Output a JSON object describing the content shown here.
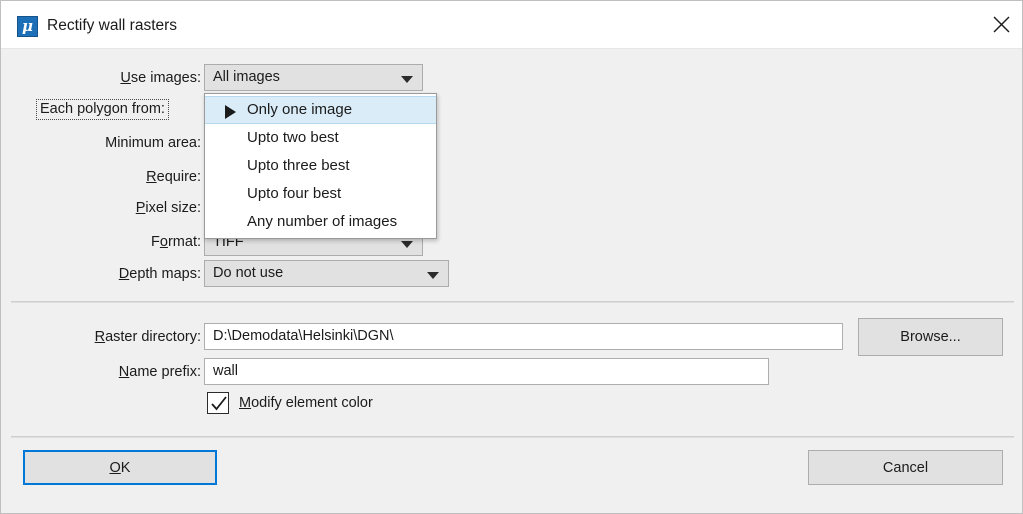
{
  "window": {
    "title": "Rectify wall rasters",
    "app_icon": "mu-icon",
    "close_icon": "close-icon",
    "background_color": "#f0f0f0",
    "accent_color": "#0078d7"
  },
  "form": {
    "rows": [
      {
        "label_prefix": "",
        "label_accel": "U",
        "label_suffix": "se images:",
        "control": "combo",
        "value": "All images"
      },
      {
        "label_prefix": "Each polygon from:",
        "label_accel": "",
        "label_suffix": "",
        "control": "combo-focused",
        "value": ""
      },
      {
        "label_prefix": "Minimum area:",
        "label_accel": "",
        "label_suffix": "",
        "control": "hidden",
        "value": ""
      },
      {
        "label_prefix": "",
        "label_accel": "R",
        "label_suffix": "equire:",
        "control": "hidden",
        "value": ""
      },
      {
        "label_prefix": "",
        "label_accel": "P",
        "label_suffix": "ixel size:",
        "control": "hidden",
        "value": ""
      },
      {
        "label_prefix": "F",
        "label_accel": "o",
        "label_suffix": "rmat:",
        "control": "combo",
        "value": "TIFF"
      },
      {
        "label_prefix": "",
        "label_accel": "D",
        "label_suffix": "epth maps:",
        "control": "combo",
        "value": "Do not use"
      }
    ],
    "use_images": {
      "label_accel": "U",
      "label_rest": "se images:",
      "value": "All images"
    },
    "each_polygon": {
      "label": "Each polygon from:"
    },
    "minimum_area": {
      "label": "Minimum area:"
    },
    "require": {
      "label_accel": "R",
      "label_rest": "equire:"
    },
    "pixel_size": {
      "label_accel": "P",
      "label_rest": "ixel size:"
    },
    "format": {
      "label_pre": "F",
      "label_accel": "o",
      "label_rest": "rmat:",
      "value": "TIFF"
    },
    "depth_maps": {
      "label_accel": "D",
      "label_rest": "epth maps:",
      "value": "Do not use"
    }
  },
  "dropdown": {
    "open": true,
    "items": [
      {
        "label": "Only one image",
        "selected": true
      },
      {
        "label": "Upto two best",
        "selected": false
      },
      {
        "label": "Upto three best",
        "selected": false
      },
      {
        "label": "Upto four best",
        "selected": false
      },
      {
        "label": "Any number of images",
        "selected": false
      }
    ]
  },
  "paths": {
    "raster_directory": {
      "label_accel": "R",
      "label_rest": "aster directory:",
      "value": "D:\\Demodata\\Helsinki\\DGN\\"
    },
    "name_prefix": {
      "label_accel": "N",
      "label_rest": "ame prefix:",
      "value": "wall"
    },
    "browse_button": "Browse..."
  },
  "options": {
    "modify_element_color": {
      "label_accel": "M",
      "label_rest": "odify element color",
      "checked": true
    }
  },
  "buttons": {
    "ok": {
      "pre": "O",
      "accel": "K",
      "label": "OK"
    },
    "cancel": {
      "label": "Cancel"
    }
  }
}
